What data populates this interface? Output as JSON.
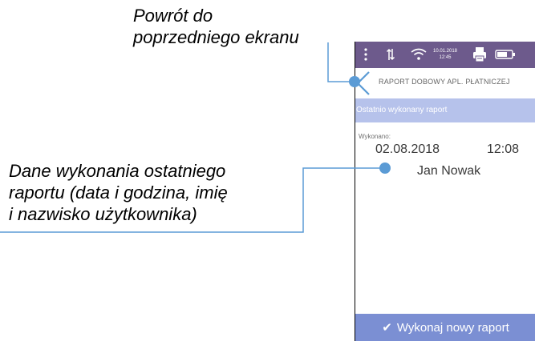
{
  "annotations": {
    "back_line1": "Powrót do",
    "back_line2": "poprzedniego ekranu",
    "data_line1": "Dane wykonania ostatniego",
    "data_line2": "raportu (data i godzina, imię",
    "data_line3": "i nazwisko użytkownika)"
  },
  "status_bar": {
    "date": "10.01.2018",
    "time": "12:45",
    "icons": [
      "menu-dots-icon",
      "data-arrows-icon",
      "wifi-icon",
      "printer-icon",
      "battery-icon"
    ]
  },
  "screen": {
    "back_icon": "back-icon",
    "title": "RAPORT DOBOWY APL. PŁATNICZEJ",
    "section_header": "Ostatnio wykonany raport",
    "done_label": "Wykonano:",
    "date": "02.08.2018",
    "time": "12:08",
    "user": "Jan Nowak",
    "action_button": "Wykonaj nowy raport"
  },
  "colors": {
    "status_bar": "#6d5a8c",
    "section_header": "#b6c2eb",
    "action_button": "#7b8fd3",
    "annotation_line": "#5b9bd5"
  }
}
